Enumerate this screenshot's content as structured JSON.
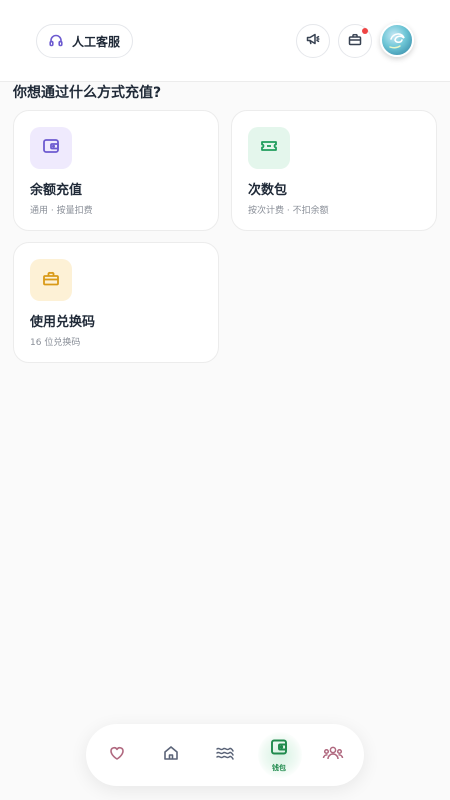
{
  "header": {
    "customer_service_label": "人工客服",
    "notification_badge": true
  },
  "section_title": "你想通过什么方式充值?",
  "options": [
    {
      "title": "余额充值",
      "subtitle": "通用 · 按量扣费",
      "icon": "wallet-icon",
      "accent": "#6d5bd0"
    },
    {
      "title": "次数包",
      "subtitle": "按次计费 · 不扣余额",
      "icon": "ticket-icon",
      "accent": "#1f9d5c"
    },
    {
      "title": "使用兑换码",
      "subtitle": "16 位兑换码",
      "icon": "gift-icon",
      "accent": "#d99a17"
    }
  ],
  "bottom_nav": {
    "items": [
      {
        "name": "favorites",
        "icon": "heart-icon"
      },
      {
        "name": "home",
        "icon": "home-icon"
      },
      {
        "name": "waves",
        "icon": "waves-icon"
      },
      {
        "name": "wallet",
        "icon": "wallet-icon",
        "label": "钱包",
        "active": true
      },
      {
        "name": "community",
        "icon": "users-icon"
      }
    ]
  },
  "colors": {
    "accent_green": "#1f8a4c",
    "badge_red": "#ef4444"
  }
}
